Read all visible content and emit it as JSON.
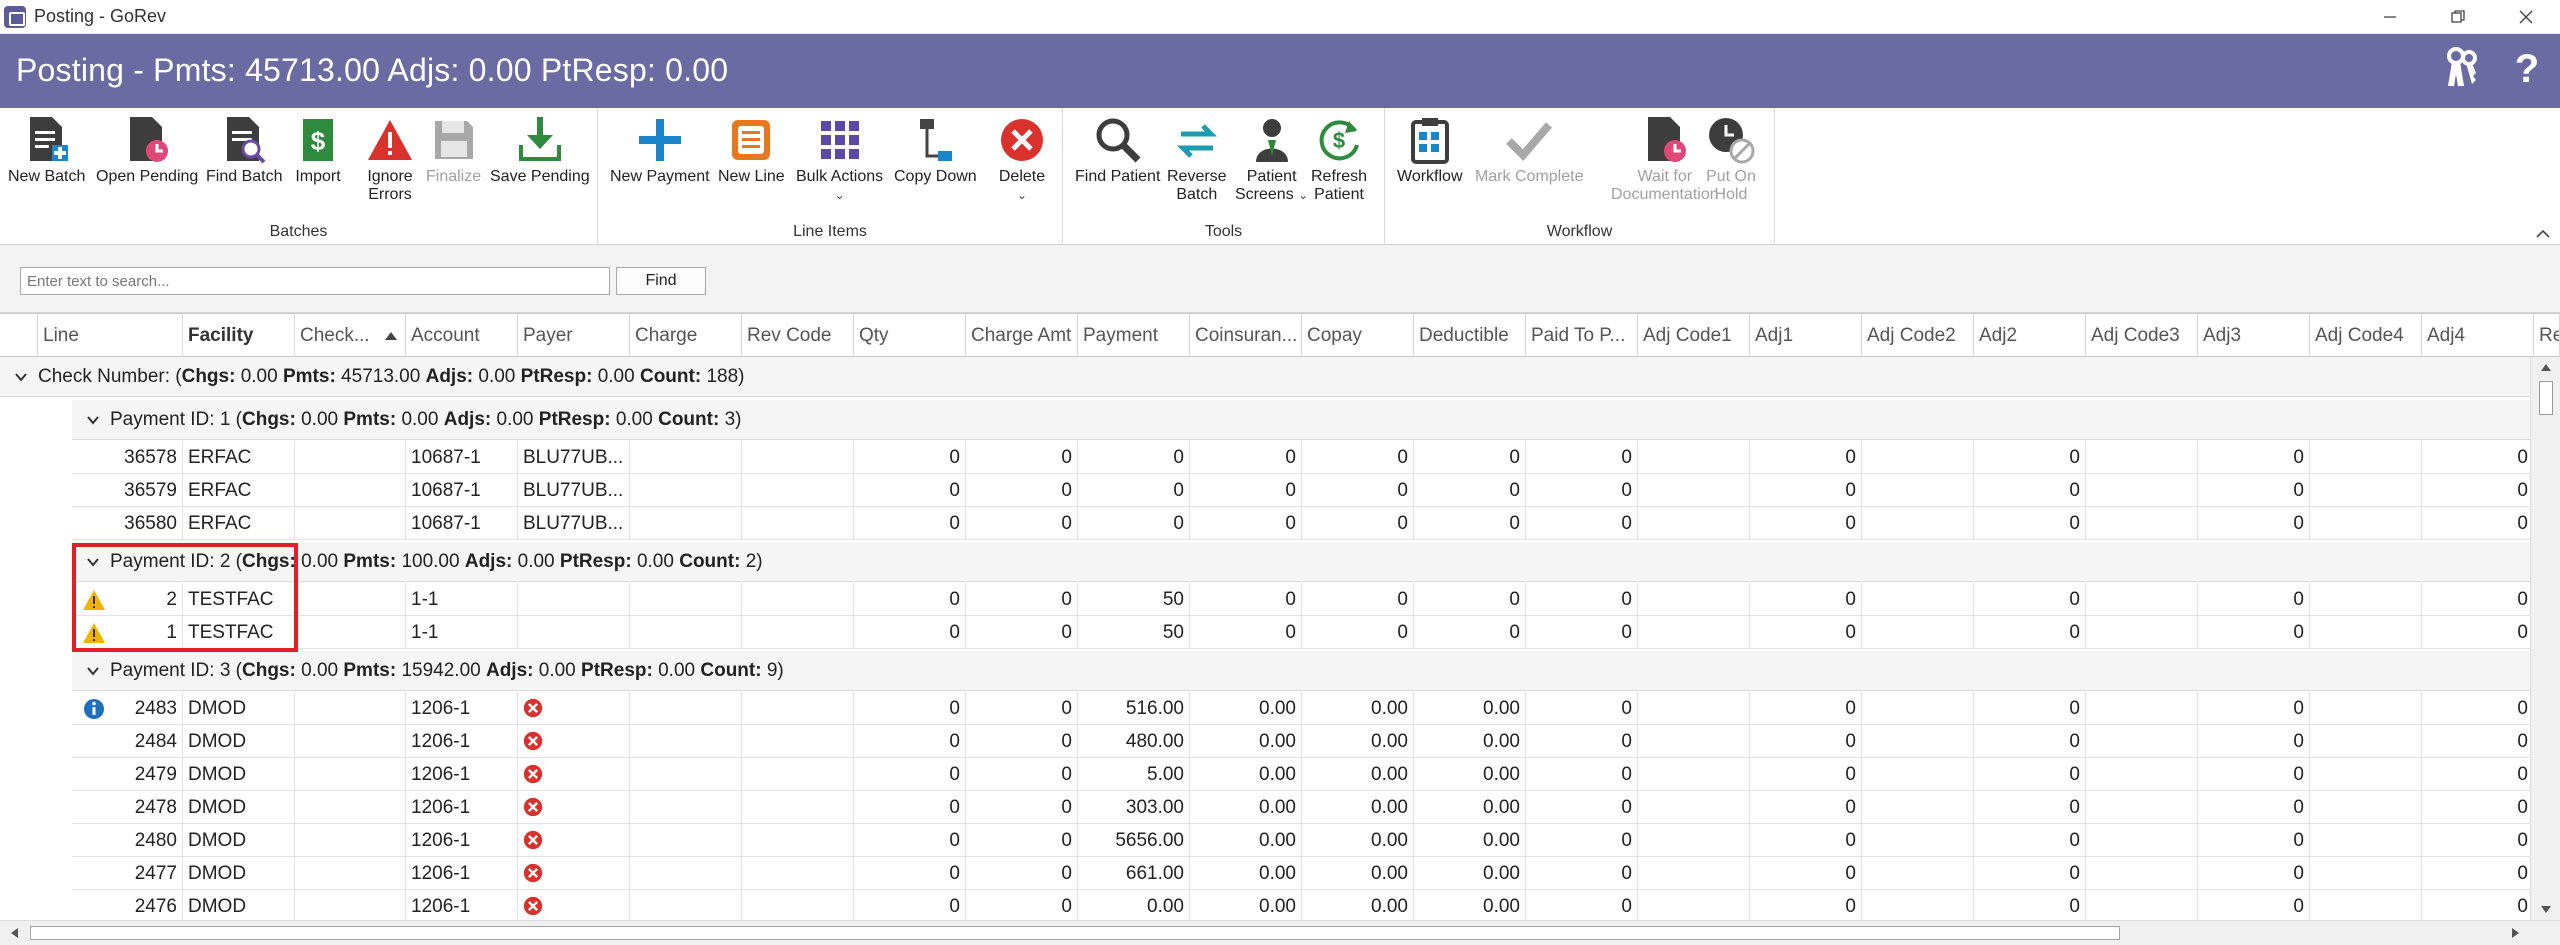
{
  "window": {
    "title": "Posting - GoRev"
  },
  "header": {
    "title": "Posting - Pmts: 45713.00 Adjs: 0.00 PtResp: 0.00"
  },
  "ribbon": {
    "groups": {
      "batches": "Batches",
      "line_items": "Line Items",
      "tools": "Tools",
      "workflow": "Workflow"
    },
    "buttons": {
      "new_batch": "New Batch",
      "open_pending": "Open Pending",
      "find_batch": "Find Batch",
      "import": "Import",
      "ignore_errors_1": "Ignore",
      "ignore_errors_2": "Errors",
      "finalize": "Finalize",
      "save_pending": "Save Pending",
      "new_payment": "New Payment",
      "new_line": "New Line",
      "bulk_actions": "Bulk Actions",
      "copy_down": "Copy Down",
      "delete": "Delete",
      "find_patient": "Find Patient",
      "reverse_batch_1": "Reverse",
      "reverse_batch_2": "Batch",
      "patient_screens_1": "Patient",
      "patient_screens_2": "Screens",
      "refresh_patient_1": "Refresh",
      "refresh_patient_2": "Patient",
      "workflow": "Workflow",
      "mark_complete": "Mark Complete",
      "wait_doc_1": "Wait for",
      "wait_doc_2": "Documentation",
      "put_on_hold_1": "Put On",
      "put_on_hold_2": "Hold"
    }
  },
  "search": {
    "placeholder": "Enter text to search...",
    "value": "",
    "find_label": "Find"
  },
  "columns": [
    "Line",
    "Facility",
    "Check...",
    "Account",
    "Payer",
    "Charge",
    "Rev Code",
    "Qty",
    "Charge Amt",
    "Payment",
    "Coinsuran...",
    "Copay",
    "Deductible",
    "Paid To P...",
    "Adj Code1",
    "Adj1",
    "Adj Code2",
    "Adj2",
    "Adj Code3",
    "Adj3",
    "Adj Code4",
    "Adj4",
    "Re"
  ],
  "check_group": {
    "label": "Check Number:",
    "chgs_key": "Chgs:",
    "chgs": "0.00",
    "pmts_key": "Pmts:",
    "pmts": "45713.00",
    "adjs_key": "Adjs:",
    "adjs": "0.00",
    "ptresp_key": "PtResp:",
    "ptresp": "0.00",
    "count_key": "Count:",
    "count": "188"
  },
  "payment_groups": [
    {
      "label": "Payment ID: 1",
      "chgs": "0.00",
      "pmts": "0.00",
      "adjs": "0.00",
      "ptresp": "0.00",
      "count": "3",
      "rows": [
        {
          "icon": "",
          "line": "36578",
          "facility": "ERFAC",
          "account": "10687-1",
          "payer": "BLU77UB...",
          "qty": "0",
          "charge_amt": "0",
          "payment": "0",
          "coins": "0",
          "copay": "0",
          "deductible": "0",
          "paid_to_p": "0",
          "adj1": "0",
          "adj2": "0",
          "adj3": "0",
          "adj4": "0"
        },
        {
          "icon": "",
          "line": "36579",
          "facility": "ERFAC",
          "account": "10687-1",
          "payer": "BLU77UB...",
          "qty": "0",
          "charge_amt": "0",
          "payment": "0",
          "coins": "0",
          "copay": "0",
          "deductible": "0",
          "paid_to_p": "0",
          "adj1": "0",
          "adj2": "0",
          "adj3": "0",
          "adj4": "0"
        },
        {
          "icon": "",
          "line": "36580",
          "facility": "ERFAC",
          "account": "10687-1",
          "payer": "BLU77UB...",
          "qty": "0",
          "charge_amt": "0",
          "payment": "0",
          "coins": "0",
          "copay": "0",
          "deductible": "0",
          "paid_to_p": "0",
          "adj1": "0",
          "adj2": "0",
          "adj3": "0",
          "adj4": "0"
        }
      ]
    },
    {
      "label": "Payment ID: 2",
      "chgs": "0.00",
      "pmts": "100.00",
      "adjs": "0.00",
      "ptresp": "0.00",
      "count": "2",
      "rows": [
        {
          "icon": "warning",
          "line": "2",
          "facility": "TESTFAC",
          "account": "1-1",
          "payer": "",
          "qty": "0",
          "charge_amt": "0",
          "payment": "50",
          "coins": "0",
          "copay": "0",
          "deductible": "0",
          "paid_to_p": "0",
          "adj1": "0",
          "adj2": "0",
          "adj3": "0",
          "adj4": "0"
        },
        {
          "icon": "warning",
          "line": "1",
          "facility": "TESTFAC",
          "account": "1-1",
          "payer": "",
          "qty": "0",
          "charge_amt": "0",
          "payment": "50",
          "coins": "0",
          "copay": "0",
          "deductible": "0",
          "paid_to_p": "0",
          "adj1": "0",
          "adj2": "0",
          "adj3": "0",
          "adj4": "0"
        }
      ]
    },
    {
      "label": "Payment ID: 3",
      "chgs": "0.00",
      "pmts": "15942.00",
      "adjs": "0.00",
      "ptresp": "0.00",
      "count": "9",
      "rows": [
        {
          "icon": "info",
          "line": "2483",
          "facility": "DMOD",
          "account": "1206-1",
          "payer": "error",
          "qty": "0",
          "charge_amt": "0",
          "payment": "516.00",
          "coins": "0.00",
          "copay": "0.00",
          "deductible": "0.00",
          "paid_to_p": "0",
          "adj1": "0",
          "adj2": "0",
          "adj3": "0",
          "adj4": "0"
        },
        {
          "icon": "",
          "line": "2484",
          "facility": "DMOD",
          "account": "1206-1",
          "payer": "error",
          "qty": "0",
          "charge_amt": "0",
          "payment": "480.00",
          "coins": "0.00",
          "copay": "0.00",
          "deductible": "0.00",
          "paid_to_p": "0",
          "adj1": "0",
          "adj2": "0",
          "adj3": "0",
          "adj4": "0"
        },
        {
          "icon": "",
          "line": "2479",
          "facility": "DMOD",
          "account": "1206-1",
          "payer": "error",
          "qty": "0",
          "charge_amt": "0",
          "payment": "5.00",
          "coins": "0.00",
          "copay": "0.00",
          "deductible": "0.00",
          "paid_to_p": "0",
          "adj1": "0",
          "adj2": "0",
          "adj3": "0",
          "adj4": "0"
        },
        {
          "icon": "",
          "line": "2478",
          "facility": "DMOD",
          "account": "1206-1",
          "payer": "error",
          "qty": "0",
          "charge_amt": "0",
          "payment": "303.00",
          "coins": "0.00",
          "copay": "0.00",
          "deductible": "0.00",
          "paid_to_p": "0",
          "adj1": "0",
          "adj2": "0",
          "adj3": "0",
          "adj4": "0"
        },
        {
          "icon": "",
          "line": "2480",
          "facility": "DMOD",
          "account": "1206-1",
          "payer": "error",
          "qty": "0",
          "charge_amt": "0",
          "payment": "5656.00",
          "coins": "0.00",
          "copay": "0.00",
          "deductible": "0.00",
          "paid_to_p": "0",
          "adj1": "0",
          "adj2": "0",
          "adj3": "0",
          "adj4": "0"
        },
        {
          "icon": "",
          "line": "2477",
          "facility": "DMOD",
          "account": "1206-1",
          "payer": "error",
          "qty": "0",
          "charge_amt": "0",
          "payment": "661.00",
          "coins": "0.00",
          "copay": "0.00",
          "deductible": "0.00",
          "paid_to_p": "0",
          "adj1": "0",
          "adj2": "0",
          "adj3": "0",
          "adj4": "0"
        },
        {
          "icon": "",
          "line": "2476",
          "facility": "DMOD",
          "account": "1206-1",
          "payer": "error",
          "qty": "0",
          "charge_amt": "0",
          "payment": "0.00",
          "coins": "0.00",
          "copay": "0.00",
          "deductible": "0.00",
          "paid_to_p": "0",
          "adj1": "0",
          "adj2": "0",
          "adj3": "0",
          "adj4": "0"
        }
      ]
    }
  ],
  "colors": {
    "header": "#6b6ba3",
    "warning": "#f0b400",
    "info": "#1f6fbf",
    "error": "#d9312b",
    "highlight": "#e21e26"
  }
}
